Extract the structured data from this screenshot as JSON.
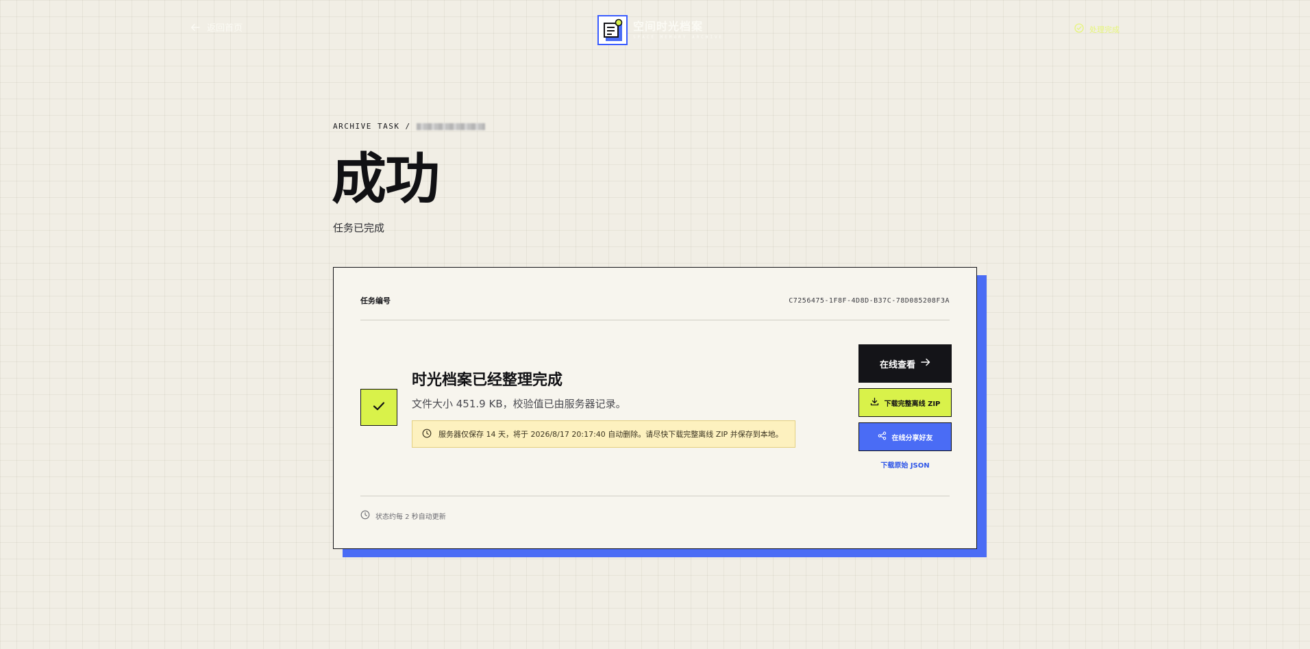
{
  "topbar": {
    "back_label": "返回首页",
    "brand_name": "空间时光档案",
    "brand_sub": "SPACE MEMORY ARCHIVE",
    "status_label": "处理完成"
  },
  "heading": {
    "breadcrumb_prefix": "ARCHIVE TASK",
    "breadcrumb_sep": "/",
    "title": "成功",
    "subtitle": "任务已完成"
  },
  "card": {
    "task_label": "任务编号",
    "task_id": "C7256475-1F8F-4D8D-B37C-78D085208F3A",
    "result_title": "时光档案已经整理完成",
    "result_desc": "文件大小 451.9 KB，校验值已由服务器记录。",
    "notice": "服务器仅保存 14 天，将于 2026/8/17 20:17:40 自动删除。请尽快下载完整离线 ZIP 并保存到本地。",
    "footer": "状态约每 2 秒自动更新"
  },
  "actions": {
    "view_label": "在线查看",
    "zip_label": "下载完整离线 ZIP",
    "share_label": "在线分享好友",
    "json_label": "下载原始 JSON"
  },
  "icons": {
    "back": "arrow-left-icon",
    "status": "check-circle-icon",
    "check": "check-icon",
    "clock": "clock-icon",
    "arrow": "arrow-right-icon",
    "download": "download-icon",
    "share": "share-icon"
  },
  "colors": {
    "background": "#f1eee5",
    "card": "#f7f5ee",
    "accent_lime": "#d9f24a",
    "accent_blue": "#4a6cf5",
    "ink": "#111114",
    "notice_bg": "#fdf1bf",
    "link_blue": "#2f56e8"
  }
}
